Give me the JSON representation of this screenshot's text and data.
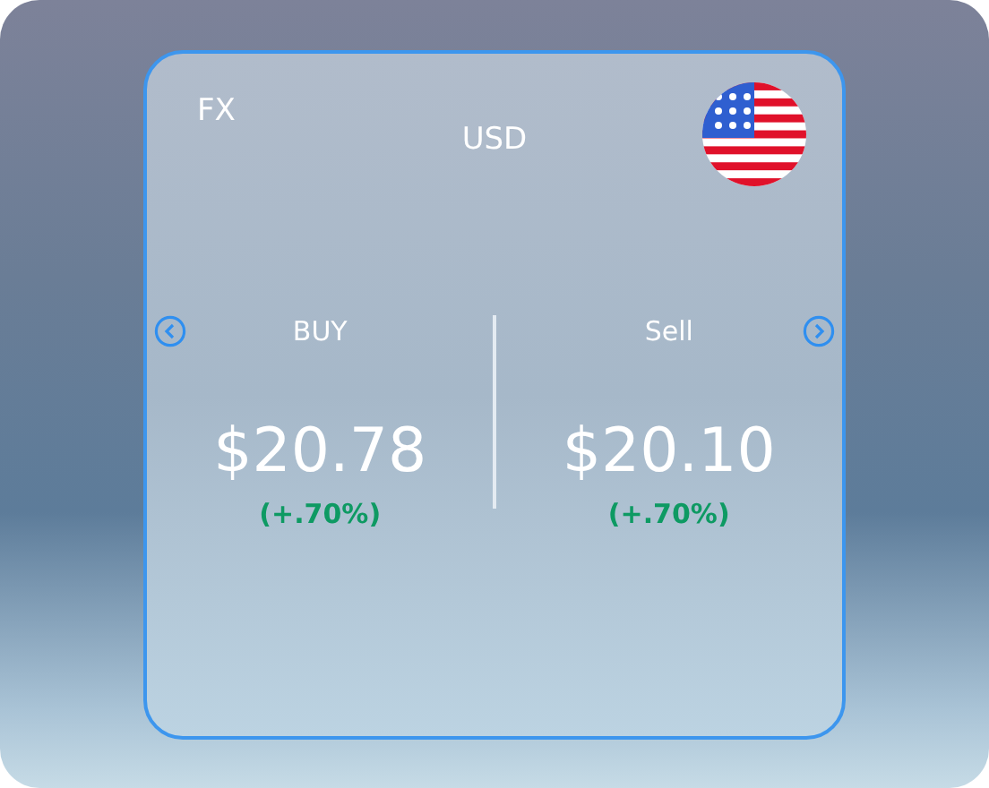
{
  "card": {
    "label": "FX",
    "currency": "USD"
  },
  "quotes": [
    {
      "label": "BUY",
      "price": "$20.78",
      "change": "(+.70%)"
    },
    {
      "label": "Sell",
      "price": "$20.10",
      "change": "(+.70%)"
    }
  ]
}
